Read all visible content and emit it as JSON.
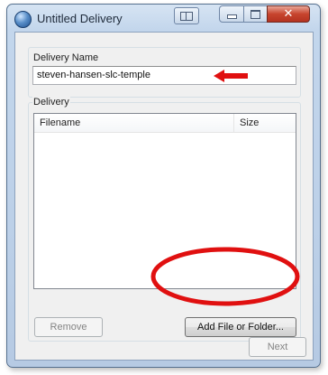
{
  "window": {
    "title": "Untitled Delivery",
    "titlebar_buttons": [
      "snap-icon",
      "minimize-icon",
      "maximize-icon",
      "close-icon"
    ]
  },
  "delivery_name": {
    "label": "Delivery Name",
    "value": "steven-hansen-slc-temple"
  },
  "delivery": {
    "label": "Delivery",
    "columns": [
      "Filename",
      "Size"
    ],
    "rows": []
  },
  "buttons": {
    "remove": "Remove",
    "add": "Add File or Folder...",
    "next": "Next"
  },
  "annotations": {
    "arrow_color": "#e01010",
    "ellipse_color": "#e01010"
  },
  "colors": {
    "close_button": "#c7442e",
    "frame": "#c3d6ec"
  }
}
